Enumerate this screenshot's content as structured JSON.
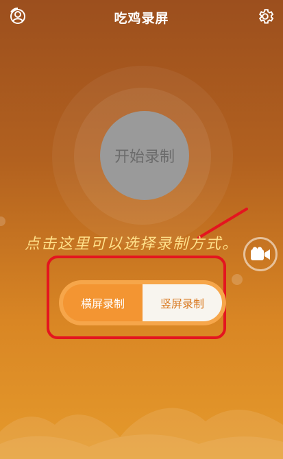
{
  "header": {
    "title": "吃鸡录屏",
    "left_icon": "user-circle-icon",
    "right_icon": "gear-icon"
  },
  "main": {
    "start_button_label": "开始录制",
    "annotation_text": "点击这里可以选择录制方式。",
    "camera_icon": "video-camera-icon"
  },
  "orientation_toggle": {
    "landscape_label": "横屏录制",
    "portrait_label": "竖屏录制",
    "selected": "landscape"
  },
  "colors": {
    "accent_orange": "#f39532",
    "highlight_red": "#e4151f",
    "annotation_yellow": "#ffe08a"
  }
}
